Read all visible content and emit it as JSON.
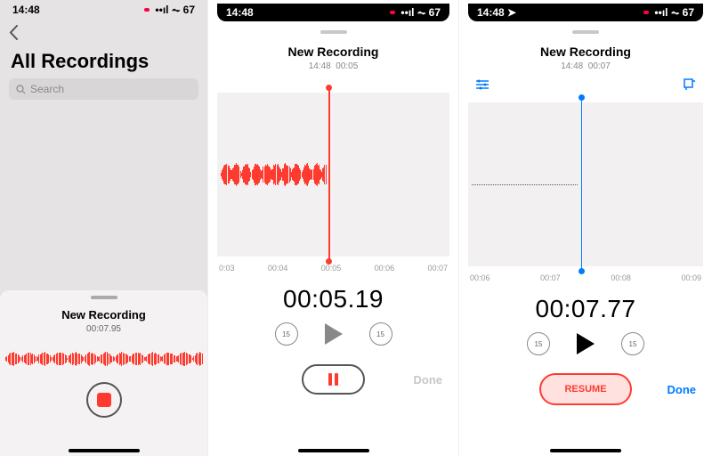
{
  "status": {
    "time": "14:48",
    "battery": "67",
    "location_arrow": true
  },
  "panel1": {
    "title": "All Recordings",
    "search_placeholder": "Search",
    "recording_name": "New Recording",
    "recording_time": "00:07.95"
  },
  "panel2": {
    "title": "New Recording",
    "sub_time": "14:48",
    "sub_duration": "00:05",
    "ticks": [
      "0:03",
      "00:04",
      "00:05",
      "00:06",
      "00:07"
    ],
    "big_time": "00:05.19",
    "skip_label": "15",
    "done_label": "Done"
  },
  "panel3": {
    "title": "New Recording",
    "sub_time": "14:48",
    "sub_duration": "00:07",
    "ticks": [
      "00:06",
      "00:07",
      "00:08",
      "00:09"
    ],
    "big_time": "00:07.77",
    "skip_label": "15",
    "resume_label": "RESUME",
    "done_label": "Done"
  },
  "colors": {
    "record_red": "#ff3b30",
    "ios_blue": "#007aff"
  }
}
